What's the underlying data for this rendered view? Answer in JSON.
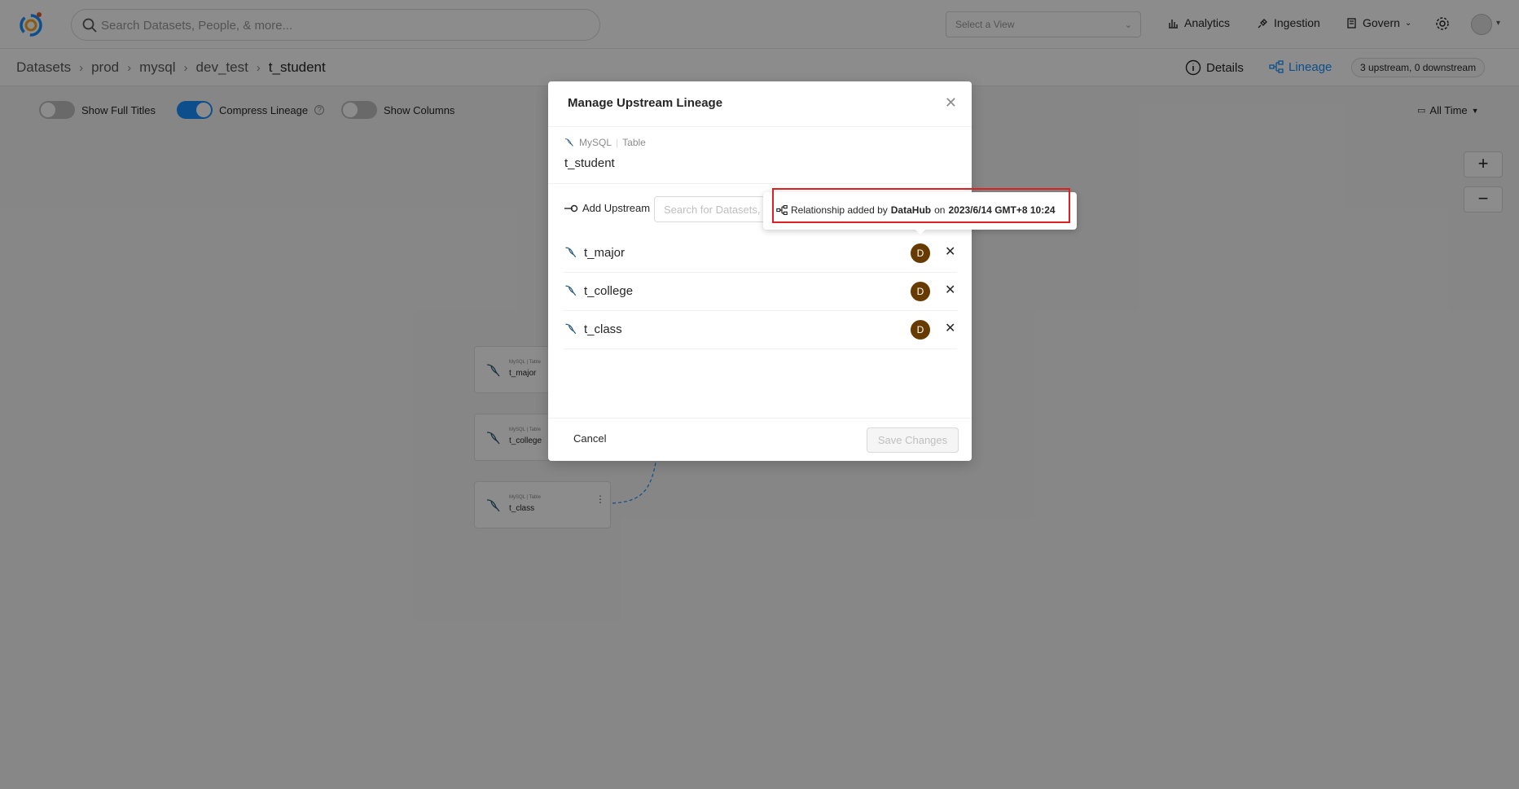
{
  "topbar": {
    "search_placeholder": "Search Datasets, People, & more...",
    "view_select_placeholder": "Select a View",
    "nav": {
      "analytics": "Analytics",
      "ingestion": "Ingestion",
      "govern": "Govern"
    }
  },
  "breadcrumb": {
    "items": [
      "Datasets",
      "prod",
      "mysql",
      "dev_test",
      "t_student"
    ]
  },
  "entity_tabs": {
    "details": "Details",
    "lineage": "Lineage",
    "count_badge": "3 upstream, 0 downstream"
  },
  "toolbar": {
    "show_full_titles": "Show Full Titles",
    "compress_lineage": "Compress Lineage",
    "show_columns": "Show Columns",
    "time_filter": "All Time"
  },
  "zoom": {
    "in": "+",
    "out": "−"
  },
  "graph_nodes": [
    {
      "platform": "MySQL",
      "type": "Table",
      "name": "t_major"
    },
    {
      "platform": "MySQL",
      "type": "Table",
      "name": "t_college"
    },
    {
      "platform": "MySQL",
      "type": "Table",
      "name": "t_class"
    }
  ],
  "modal": {
    "title": "Manage Upstream Lineage",
    "entity": {
      "platform": "MySQL",
      "type": "Table",
      "name": "t_student"
    },
    "add_upstream_label": "Add Upstream",
    "add_upstream_placeholder": "Search for Datasets, T",
    "upstreams": [
      {
        "name": "t_major",
        "owner_initial": "D"
      },
      {
        "name": "t_college",
        "owner_initial": "D"
      },
      {
        "name": "t_class",
        "owner_initial": "D"
      }
    ],
    "cancel_label": "Cancel",
    "save_label": "Save Changes"
  },
  "tooltip": {
    "prefix": "Relationship added by",
    "actor": "DataHub",
    "on": "on",
    "timestamp": "2023/6/14 GMT+8 10:24"
  },
  "colors": {
    "accent": "#1890ff",
    "owner_avatar": "#663a00",
    "highlight": "#e02020"
  }
}
